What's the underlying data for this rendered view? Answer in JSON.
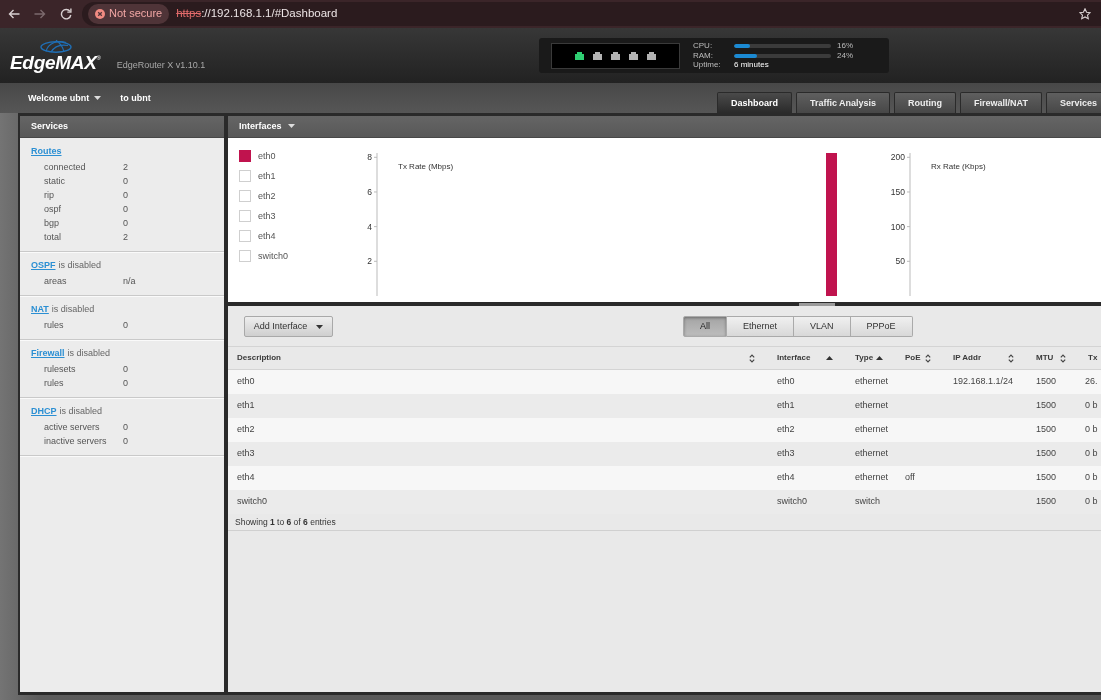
{
  "browser": {
    "nav_buttons": [
      {
        "kind": "back",
        "disabled": false
      },
      {
        "kind": "forward",
        "disabled": true
      },
      {
        "kind": "reload",
        "disabled": false
      }
    ],
    "security_label": "Not secure",
    "url": {
      "scheme": "https",
      "rest": "://192.168.1.1/#Dashboard"
    }
  },
  "header": {
    "logo": "EdgeMAX$^{®}$",
    "model": "EdgeRouter X v1.10.1",
    "ports": [
      {
        "linked": true
      },
      {
        "linked": false
      },
      {
        "linked": false
      },
      {
        "linked": false
      },
      {
        "linked": false
      }
    ],
    "stats": [
      {
        "label": "CPU:",
        "level": 0.16,
        "reading": "16%"
      },
      {
        "label": "RAM:",
        "level": 0.24,
        "reading": "24%"
      }
    ],
    "uptime": {
      "label": "Uptime:",
      "value": "6 minutes"
    }
  },
  "user_menu": {
    "label": "Welcome ubnt",
    "note": "to ubnt"
  },
  "tabs": [
    {
      "label": "Dashboard",
      "selected": true
    },
    {
      "label": "Traffic Analysis",
      "selected": false
    },
    {
      "label": "Routing",
      "selected": false
    },
    {
      "label": "Firewall/NAT",
      "selected": false
    },
    {
      "label": "Services",
      "selected": false
    }
  ],
  "services_panel": {
    "title": "Services",
    "sections": [
      {
        "link": "Routes",
        "rows": [
          {
            "label": "connected",
            "value": "2"
          },
          {
            "label": "static",
            "value": "0"
          },
          {
            "label": "rip",
            "value": "0"
          },
          {
            "label": "ospf",
            "value": "0"
          },
          {
            "label": "bgp",
            "value": "0"
          },
          {
            "label": "total",
            "value": "2"
          }
        ]
      },
      {
        "link": "OSPF",
        "status": "is disabled",
        "rows": [
          {
            "label": "areas",
            "value": "n/a"
          }
        ]
      },
      {
        "link": "NAT",
        "status": "is disabled",
        "rows": [
          {
            "label": "rules",
            "value": "0"
          }
        ]
      },
      {
        "link": "Firewall",
        "status": "is disabled",
        "rows": [
          {
            "label": "rulesets",
            "value": "0"
          },
          {
            "label": "rules",
            "value": "0"
          }
        ]
      },
      {
        "link": "DHCP",
        "status": "is disabled",
        "rows": [
          {
            "label": "active servers",
            "value": "0"
          },
          {
            "label": "inactive servers",
            "value": "0"
          }
        ]
      }
    ]
  },
  "interfaces_panel": {
    "title": "Interfaces",
    "legend": [
      {
        "label": "eth0",
        "checked": true,
        "color": "#c0134e"
      },
      {
        "label": "eth1",
        "checked": false
      },
      {
        "label": "eth2",
        "checked": false
      },
      {
        "label": "eth3",
        "checked": false
      },
      {
        "label": "eth4",
        "checked": false
      },
      {
        "label": "switch0",
        "checked": false
      }
    ],
    "graphs": [
      {
        "title": "Tx Rate (Mbps)",
        "axis_labels": [
          "8",
          "6",
          "4",
          "2"
        ],
        "has_trace": true
      },
      {
        "title": "Rx Rate (Kbps)",
        "axis_labels": [
          "200",
          "150",
          "100",
          "50"
        ],
        "has_trace": false
      }
    ]
  },
  "interfaces_table": {
    "add_button": "Add Interface",
    "filters": [
      {
        "label": "All",
        "selected": true
      },
      {
        "label": "Ethernet",
        "selected": false
      },
      {
        "label": "VLAN",
        "selected": false
      },
      {
        "label": "PPPoE",
        "selected": false
      }
    ],
    "columns": [
      {
        "label": "Description",
        "kind": "sortable"
      },
      {
        "label": "Interface",
        "kind": "sorted"
      },
      {
        "label": "Type",
        "kind": "sorted"
      },
      {
        "label": "PoE",
        "kind": "sortable"
      },
      {
        "label": "IP Addr",
        "kind": "sortable"
      },
      {
        "label": "MTU",
        "kind": "sortable"
      },
      {
        "label": "Tx",
        "kind": "plain"
      }
    ],
    "rows": [
      {
        "description": "eth0",
        "interface": "eth0",
        "type": "ethernet",
        "ip_addr": "192.168.1.1/24",
        "mtu": "1500",
        "tx": "26."
      },
      {
        "description": "eth1",
        "interface": "eth1",
        "type": "ethernet",
        "mtu": "1500",
        "tx": "0 b"
      },
      {
        "description": "eth2",
        "interface": "eth2",
        "type": "ethernet",
        "mtu": "1500",
        "tx": "0 b"
      },
      {
        "description": "eth3",
        "interface": "eth3",
        "type": "ethernet",
        "mtu": "1500",
        "tx": "0 b"
      },
      {
        "description": "eth4",
        "interface": "eth4",
        "type": "ethernet",
        "poe": "off",
        "mtu": "1500",
        "tx": "0 b"
      },
      {
        "description": "switch0",
        "interface": "switch0",
        "type": "switch",
        "mtu": "1500",
        "tx": "0 b"
      }
    ],
    "footer": "Showing **1** to **6** of **6** entries"
  }
}
